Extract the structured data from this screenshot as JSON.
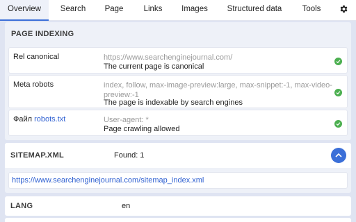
{
  "tabs": [
    {
      "label": "Overview",
      "active": true
    },
    {
      "label": "Search"
    },
    {
      "label": "Page"
    },
    {
      "label": "Links"
    },
    {
      "label": "Images"
    },
    {
      "label": "Structured data"
    },
    {
      "label": "Tools"
    }
  ],
  "settings_icon": "gear-icon",
  "page_indexing": {
    "title": "PAGE INDEXING",
    "rows": [
      {
        "label": "Rel canonical",
        "detail": "https://www.searchenginejournal.com/",
        "status": "The current page is canonical",
        "icon": "check-circle-icon"
      },
      {
        "label": "Meta robots",
        "detail": "index, follow, max-image-preview:large, max-snippet:-1, max-video-preview:-1",
        "status": "The page is indexable by search engines",
        "icon": "check-circle-icon"
      },
      {
        "label_prefix": "Файл",
        "label_link": "robots.txt",
        "detail": "User-agent: *",
        "status": "Page crawling allowed",
        "icon": "check-circle-icon"
      }
    ]
  },
  "sitemap": {
    "title": "SITEMAP.XML",
    "found": "Found: 1",
    "url": "https://www.searchenginejournal.com/sitemap_index.xml",
    "toggle_icon": "chevron-up-icon"
  },
  "lang": {
    "title": "LANG",
    "value": "en"
  },
  "colors": {
    "accent": "#3b6fd8",
    "link": "#2d5fd1",
    "ok": "#4caf50",
    "background": "#dfe4f2"
  }
}
